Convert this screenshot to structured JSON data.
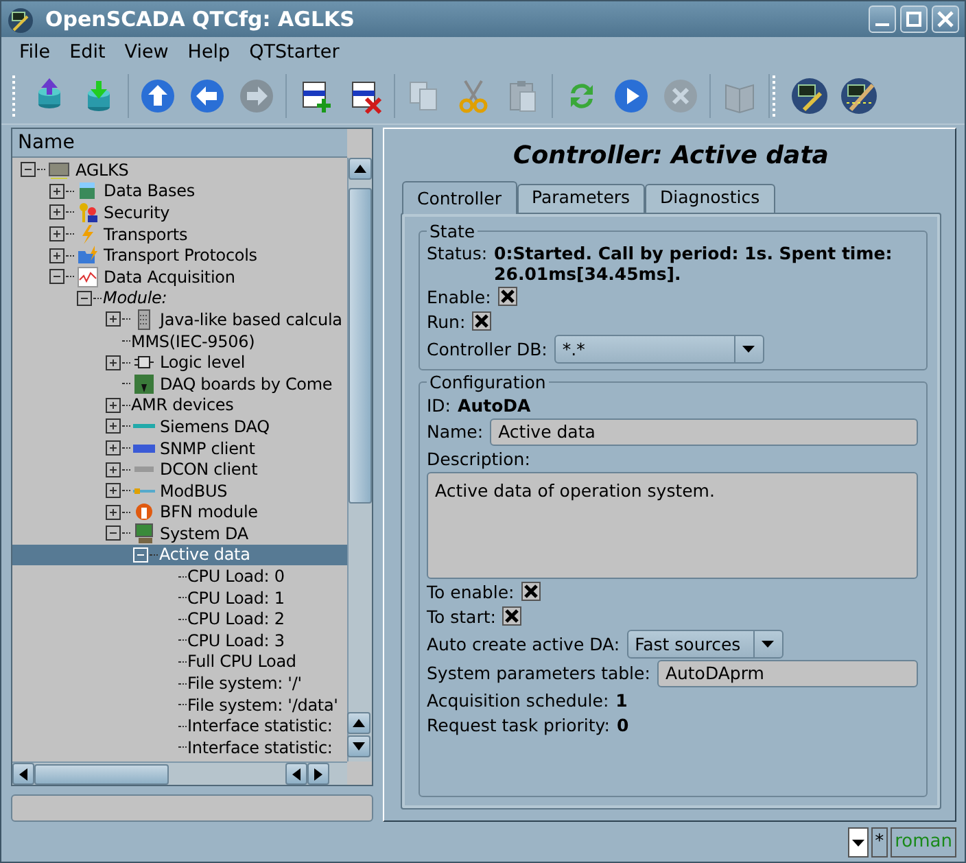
{
  "window": {
    "title": "OpenSCADA QTCfg: AGLKS"
  },
  "menu": [
    "File",
    "Edit",
    "View",
    "Help",
    "QTStarter"
  ],
  "toolbar": [
    [
      {
        "kind": "db-load",
        "disabled": false
      },
      {
        "kind": "db-save",
        "disabled": false
      }
    ],
    [
      {
        "kind": "up",
        "disabled": false
      },
      {
        "kind": "back",
        "disabled": false
      },
      {
        "kind": "forward",
        "disabled": true
      }
    ],
    [
      {
        "kind": "item-add",
        "disabled": false
      },
      {
        "kind": "item-delete",
        "disabled": false
      }
    ],
    [
      {
        "kind": "copy",
        "disabled": true
      },
      {
        "kind": "cut",
        "disabled": false
      },
      {
        "kind": "paste",
        "disabled": true
      }
    ],
    [
      {
        "kind": "refresh",
        "disabled": false
      },
      {
        "kind": "start",
        "disabled": false
      },
      {
        "kind": "stop",
        "disabled": true
      }
    ],
    [
      {
        "kind": "book",
        "disabled": true
      }
    ],
    [
      {
        "kind": "app",
        "disabled": false
      },
      {
        "kind": "app-edit",
        "disabled": false
      }
    ]
  ],
  "tree": {
    "header": "Name",
    "nodes": [
      {
        "label": "AGLKS",
        "kind": "station",
        "expanded": true,
        "selected": false,
        "children": [
          {
            "label": "Data Bases",
            "kind": "database",
            "expanded": false,
            "selected": false
          },
          {
            "label": "Security",
            "kind": "security",
            "expanded": false,
            "selected": false
          },
          {
            "label": "Transports",
            "kind": "transport",
            "expanded": false,
            "selected": false
          },
          {
            "label": "Transport Protocols",
            "kind": "protocol",
            "expanded": false,
            "selected": false
          },
          {
            "label": "Data Acquisition",
            "kind": "daq",
            "expanded": true,
            "selected": false,
            "children": [
              {
                "label": "Module:",
                "kind": "group",
                "expanded": true,
                "selected": false,
                "children": [
                  {
                    "label": "Java-like based calcula",
                    "kind": "calc",
                    "expanded": false,
                    "selected": false
                  },
                  {
                    "label": "MMS(IEC-9506)",
                    "selected": false
                  },
                  {
                    "label": "Logic level",
                    "kind": "logic",
                    "expanded": false,
                    "selected": false
                  },
                  {
                    "label": "DAQ boards by Come",
                    "kind": "board",
                    "selected": false
                  },
                  {
                    "label": "AMR devices",
                    "expanded": false,
                    "selected": false
                  },
                  {
                    "label": "Siemens DAQ",
                    "kind": "siemens",
                    "expanded": false,
                    "selected": false
                  },
                  {
                    "label": "SNMP client",
                    "kind": "snmp",
                    "expanded": false,
                    "selected": false
                  },
                  {
                    "label": "DCON client",
                    "kind": "dcon",
                    "expanded": false,
                    "selected": false
                  },
                  {
                    "label": "ModBUS",
                    "kind": "modbus",
                    "expanded": false,
                    "selected": false
                  },
                  {
                    "label": "BFN module",
                    "kind": "bfn",
                    "expanded": false,
                    "selected": false
                  },
                  {
                    "label": "System DA",
                    "kind": "system",
                    "expanded": true,
                    "selected": false,
                    "children": [
                      {
                        "label": "Active data",
                        "expanded": true,
                        "selected": true,
                        "children": [
                          {
                            "label": "CPU Load: 0",
                            "selected": false
                          },
                          {
                            "label": "CPU Load: 1",
                            "selected": false
                          },
                          {
                            "label": "CPU Load: 2",
                            "selected": false
                          },
                          {
                            "label": "CPU Load: 3",
                            "selected": false
                          },
                          {
                            "label": "Full CPU Load",
                            "selected": false
                          },
                          {
                            "label": "File system: '/'",
                            "selected": false
                          },
                          {
                            "label": "File system: '/data'",
                            "selected": false
                          },
                          {
                            "label": "Interface statistic:",
                            "selected": false
                          },
                          {
                            "label": "Interface statistic:",
                            "selected": false
                          }
                        ]
                      }
                    ]
                  }
                ]
              }
            ]
          }
        ]
      }
    ]
  },
  "panel": {
    "title": "Controller: Active data",
    "tabs": [
      {
        "label": "Controller",
        "selected": true
      },
      {
        "label": "Parameters",
        "selected": false
      },
      {
        "label": "Diagnostics",
        "selected": false
      }
    ],
    "state": {
      "legend": "State",
      "status_label": "Status:",
      "status": "0:Started. Call by period: 1s. Spent time: 26.01ms[34.45ms].",
      "checks": [
        {
          "label": "Enable:",
          "checked": true
        },
        {
          "label": "Run:",
          "checked": true
        }
      ],
      "db": {
        "label": "Controller DB:",
        "value": "*.*"
      }
    },
    "configuration": {
      "legend": "Configuration",
      "id_label": "ID:",
      "id": "AutoDA",
      "name": {
        "label": "Name:",
        "value": "Active data"
      },
      "description": {
        "label": "Description:",
        "value": "Active data of operation system."
      },
      "checks": [
        {
          "label": "To enable:",
          "checked": true
        },
        {
          "label": "To start:",
          "checked": true
        }
      ],
      "auto_create": {
        "label": "Auto create active DA:",
        "value": "Fast sources"
      },
      "params_table": {
        "label": "System parameters table:",
        "value": "AutoDAprm"
      },
      "schedule": {
        "label": "Acquisition schedule:",
        "value": "1"
      },
      "priority": {
        "label": "Request task priority:",
        "value": "0"
      }
    }
  },
  "status_bar": {
    "marker": "*",
    "user": "roman"
  }
}
